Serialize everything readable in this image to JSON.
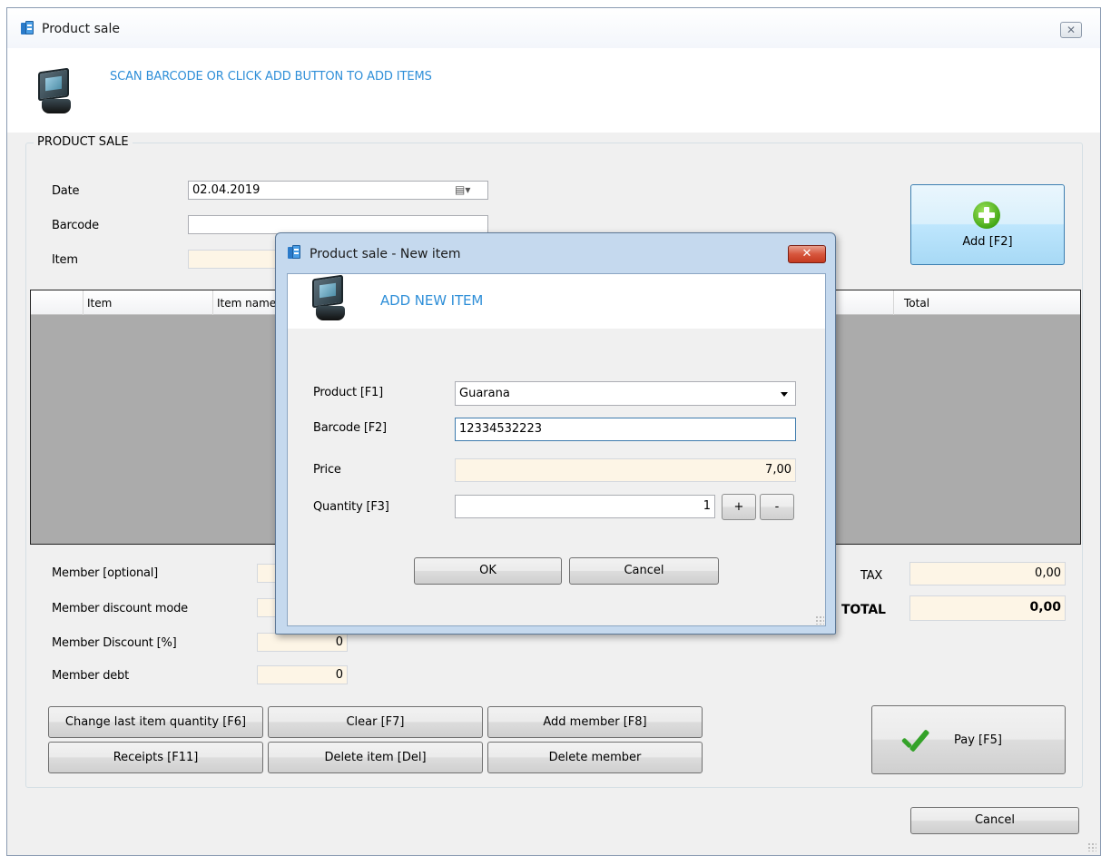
{
  "window": {
    "title": "Product sale",
    "close_glyph": "✕",
    "header_text": "SCAN BARCODE OR CLICK ADD BUTTON TO ADD ITEMS"
  },
  "sale": {
    "group_title": "PRODUCT SALE",
    "date_label": "Date",
    "date_value": "02.04.2019",
    "barcode_label": "Barcode",
    "barcode_value": "",
    "item_label": "Item",
    "item_value": "",
    "add_button": "Add [F2]"
  },
  "grid": {
    "columns": [
      "Item",
      "Item name",
      "Total"
    ]
  },
  "member": {
    "member_label": "Member [optional]",
    "mode_label": "Member discount mode",
    "discount_label": "Member Discount [%]",
    "discount_value": "0",
    "debt_label": "Member debt",
    "debt_value": "0"
  },
  "totals": {
    "tax_label": "TAX",
    "tax_value": "0,00",
    "total_label": "TOTAL",
    "total_value": "0,00"
  },
  "actions": {
    "change_qty": "Change last item quantity [F6]",
    "clear": "Clear [F7]",
    "add_member": "Add member [F8]",
    "receipts": "Receipts [F11]",
    "delete_item": "Delete item [Del]",
    "delete_member": "Delete member",
    "pay": "Pay [F5]",
    "cancel": "Cancel"
  },
  "dialog": {
    "title": "Product sale - New item",
    "close_glyph": "✕",
    "header_text": "ADD NEW ITEM",
    "product_label": "Product [F1]",
    "product_value": "Guarana",
    "barcode_label": "Barcode [F2]",
    "barcode_value": "12334532223",
    "price_label": "Price",
    "price_value": "7,00",
    "quantity_label": "Quantity [F3]",
    "quantity_value": "1",
    "plus": "+",
    "minus": "-",
    "ok": "OK",
    "cancel": "Cancel"
  },
  "icons": {
    "app": "app-window-icon",
    "pos": "pos-terminal-icon",
    "add": "green-plus-icon",
    "pay": "green-check-icon",
    "calendar": "calendar-dropdown-icon"
  },
  "colors": {
    "header_text": "#2f8fd8",
    "readonly_field": "#fdf5e6",
    "grid_background": "#ababab",
    "dialog_close": "#c43a20",
    "add_button_highlight": "#bee6fd"
  }
}
